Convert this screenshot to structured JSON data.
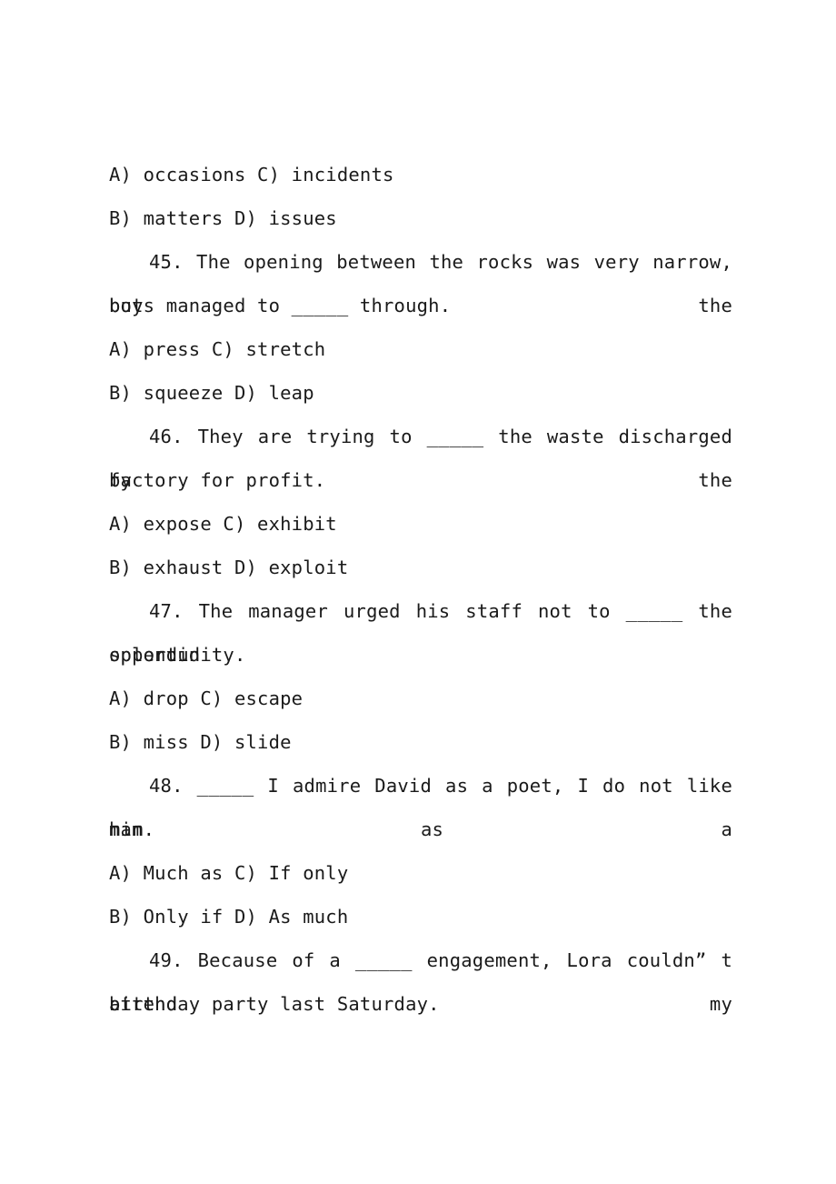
{
  "document": {
    "background_color": "#ffffff",
    "text_color": "#1a1a1a",
    "blank": "_____"
  },
  "questions": [
    {
      "id": "q44",
      "number": "",
      "stem_lines": [],
      "options": [
        {
          "left": "A) occasions",
          "right": "C) incidents",
          "line": "A) occasions C) incidents"
        },
        {
          "left": "B) matters",
          "right": "D) issues",
          "line": "B) matters D) issues"
        }
      ]
    },
    {
      "id": "q45",
      "number": "45.",
      "stem_lines": [
        "45. The opening between the rocks was very narrow, but the",
        "boys managed to _____ through."
      ],
      "options": [
        {
          "left": "A) press",
          "right": "C) stretch",
          "line": "A) press C) stretch"
        },
        {
          "left": "B) squeeze",
          "right": "D) leap",
          "line": "B) squeeze D) leap"
        }
      ]
    },
    {
      "id": "q46",
      "number": "46.",
      "stem_lines": [
        "46. They are trying to _____ the waste discharged by the",
        "factory for profit."
      ],
      "options": [
        {
          "left": "A) expose",
          "right": "C) exhibit",
          "line": "A) expose C) exhibit"
        },
        {
          "left": "B) exhaust",
          "right": "D) exploit",
          "line": "B) exhaust D) exploit"
        }
      ]
    },
    {
      "id": "q47",
      "number": "47.",
      "stem_lines": [
        "47. The manager urged his staff not to _____ the splendid",
        "opportunity."
      ],
      "options": [
        {
          "left": "A) drop",
          "right": "C) escape",
          "line": "A) drop C) escape"
        },
        {
          "left": "B) miss",
          "right": "D) slide",
          "line": "B) miss D) slide"
        }
      ]
    },
    {
      "id": "q48",
      "number": "48.",
      "stem_lines": [
        "48. _____ I admire David as a poet, I do not like him as a",
        "man."
      ],
      "options": [
        {
          "left": "A) Much as",
          "right": "C) If only",
          "line": "A) Much as C) If only"
        },
        {
          "left": "B) Only if",
          "right": "D) As much",
          "line": "B) Only if D) As much"
        }
      ]
    },
    {
      "id": "q49",
      "number": "49.",
      "stem_lines": [
        "49. Because of a _____ engagement, Lora couldn” t attend my",
        "birthday party last Saturday."
      ],
      "options": []
    }
  ]
}
